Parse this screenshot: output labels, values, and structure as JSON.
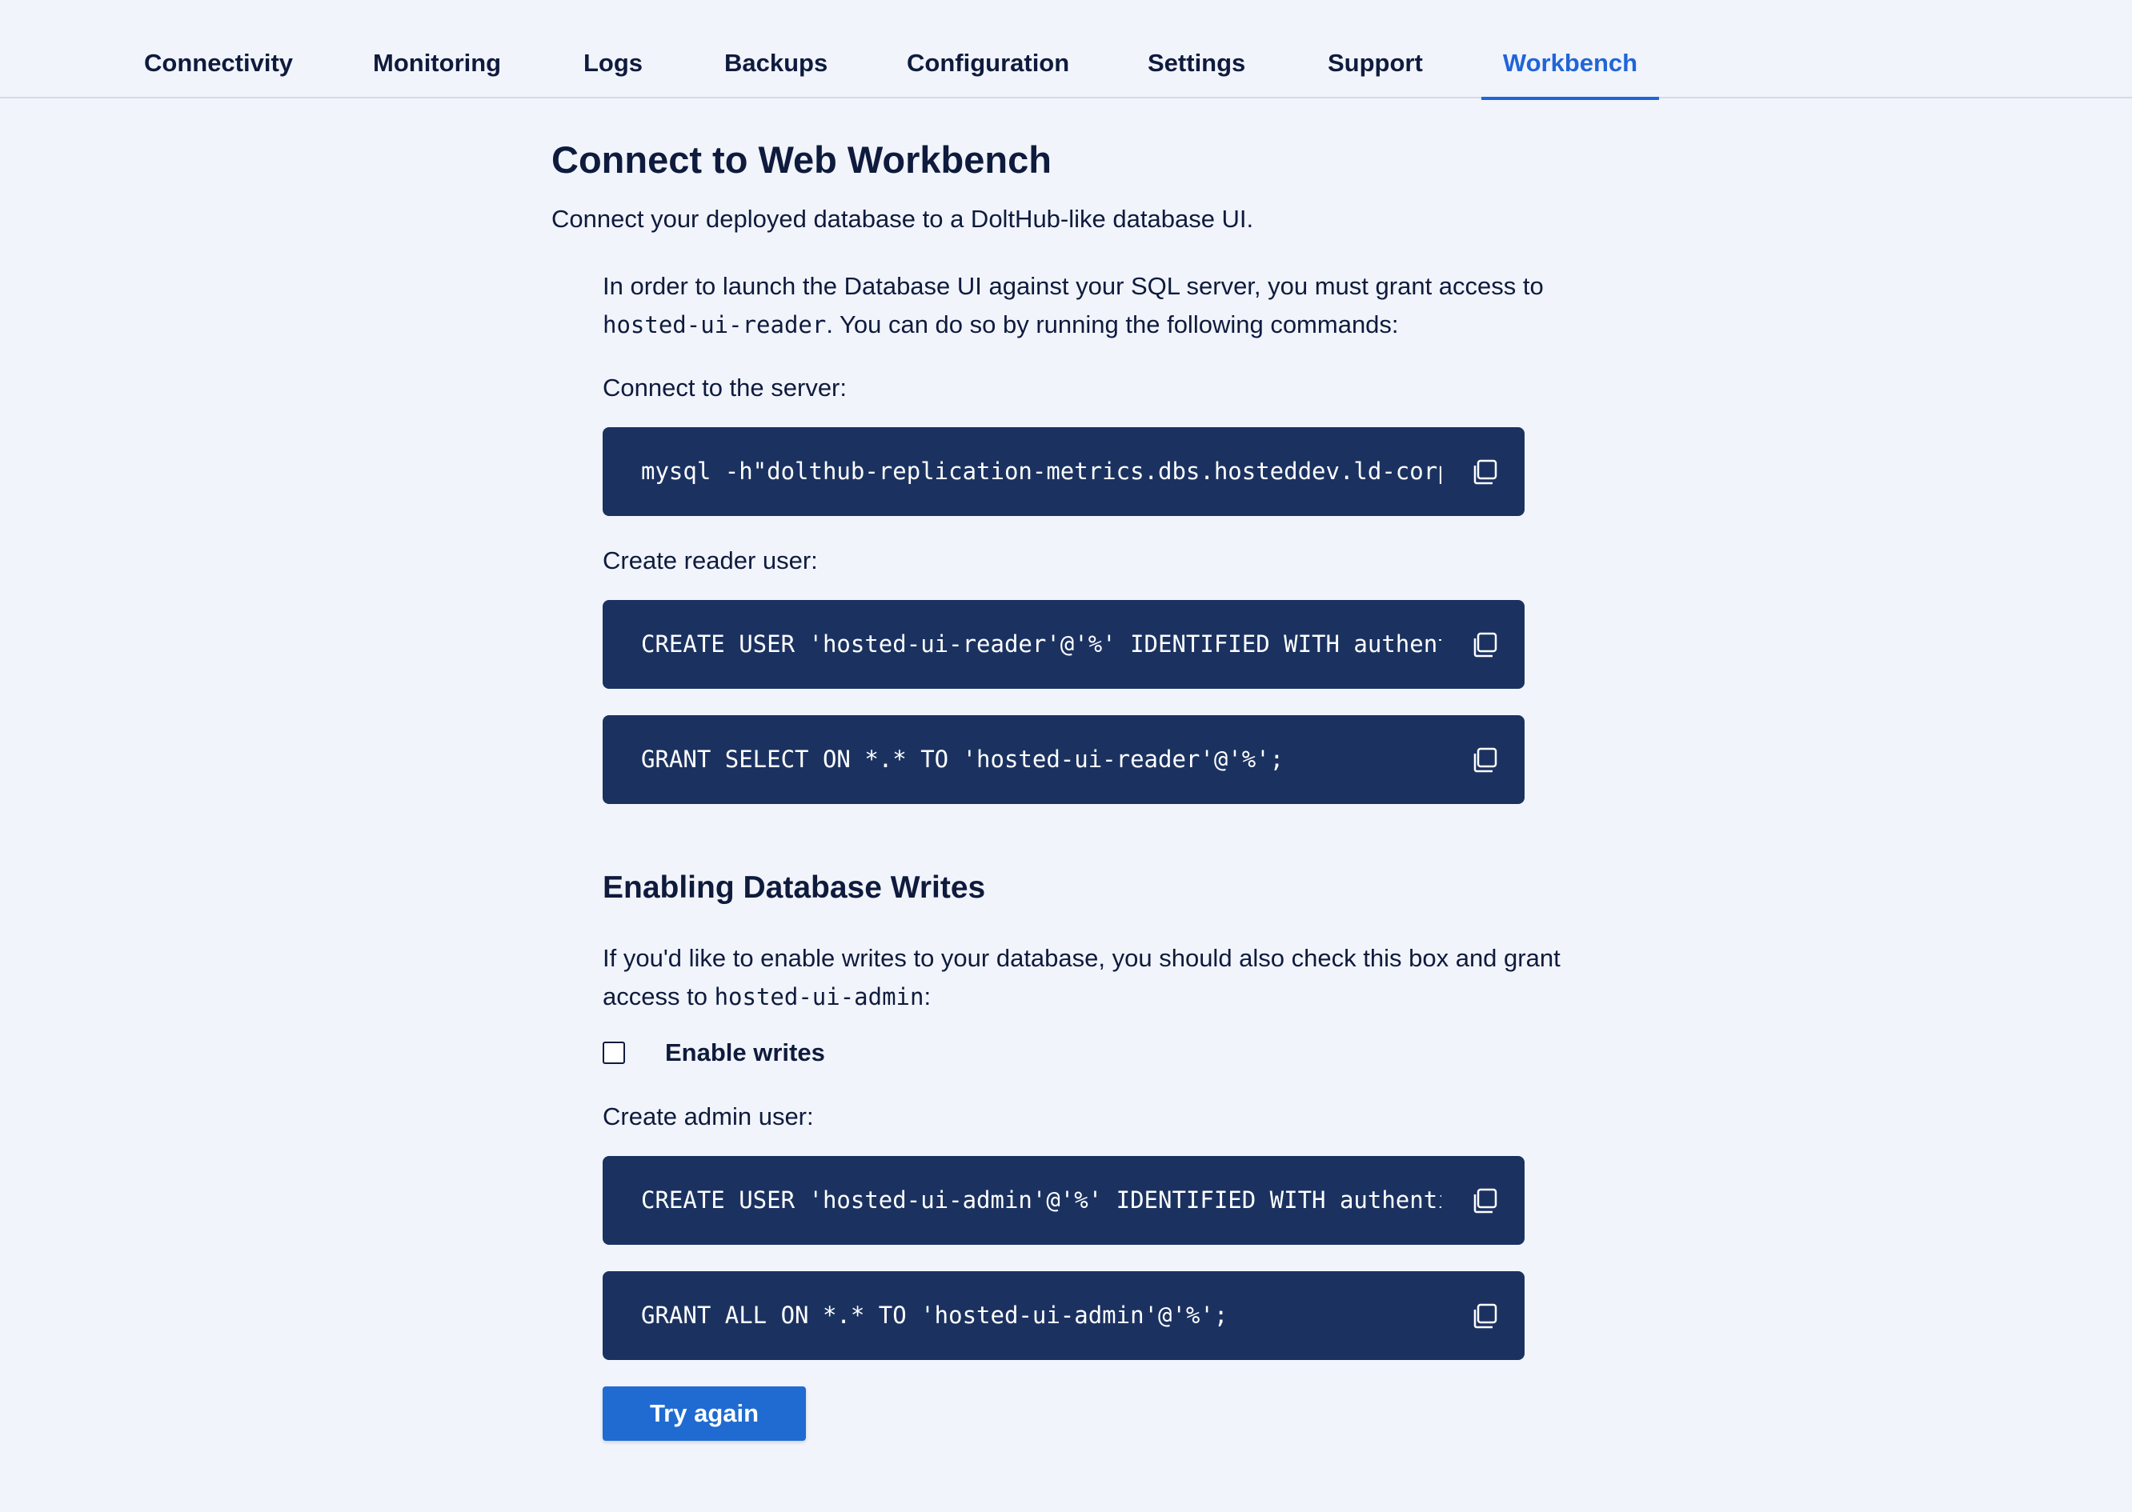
{
  "tabs": [
    {
      "label": "Connectivity",
      "active": false
    },
    {
      "label": "Monitoring",
      "active": false
    },
    {
      "label": "Logs",
      "active": false
    },
    {
      "label": "Backups",
      "active": false
    },
    {
      "label": "Configuration",
      "active": false
    },
    {
      "label": "Settings",
      "active": false
    },
    {
      "label": "Support",
      "active": false
    },
    {
      "label": "Workbench",
      "active": true
    }
  ],
  "page": {
    "title": "Connect to Web Workbench",
    "subtitle": "Connect your deployed database to a DoltHub-like database UI."
  },
  "intro": {
    "text_before": "In order to launch the Database UI against your SQL server, you must grant access to ",
    "reader_code": "hosted-ui-reader",
    "text_after": ". You can do so by running the following commands:"
  },
  "labels": {
    "connect_server": "Connect to the server:",
    "create_reader": "Create reader user:",
    "create_admin": "Create admin user:"
  },
  "commands": {
    "connect": "mysql -h\"dolthub-replication-metrics.dbs.hosteddev.ld-corp.com\"",
    "create_reader": "CREATE USER 'hosted-ui-reader'@'%' IDENTIFIED WITH authentication_string;",
    "grant_reader": "GRANT SELECT ON *.* TO 'hosted-ui-reader'@'%';",
    "create_admin": "CREATE USER 'hosted-ui-admin'@'%' IDENTIFIED WITH authentication_string;",
    "grant_admin": "GRANT ALL ON *.* TO 'hosted-ui-admin'@'%';"
  },
  "writes": {
    "title": "Enabling Database Writes",
    "text_before": "If you'd like to enable writes to your database, you should also check this box and grant access to ",
    "admin_code": "hosted-ui-admin",
    "text_after": ":",
    "checkbox_label": "Enable writes",
    "checkbox_checked": false
  },
  "button": {
    "try_again": "Try again"
  },
  "icons": {
    "copy": "copy-icon"
  },
  "colors": {
    "accent": "#2065d8",
    "code_bg": "#1b3261",
    "button_bg": "#1f6bd1",
    "page_bg": "#f1f4fb",
    "text": "#0f1b3d"
  }
}
